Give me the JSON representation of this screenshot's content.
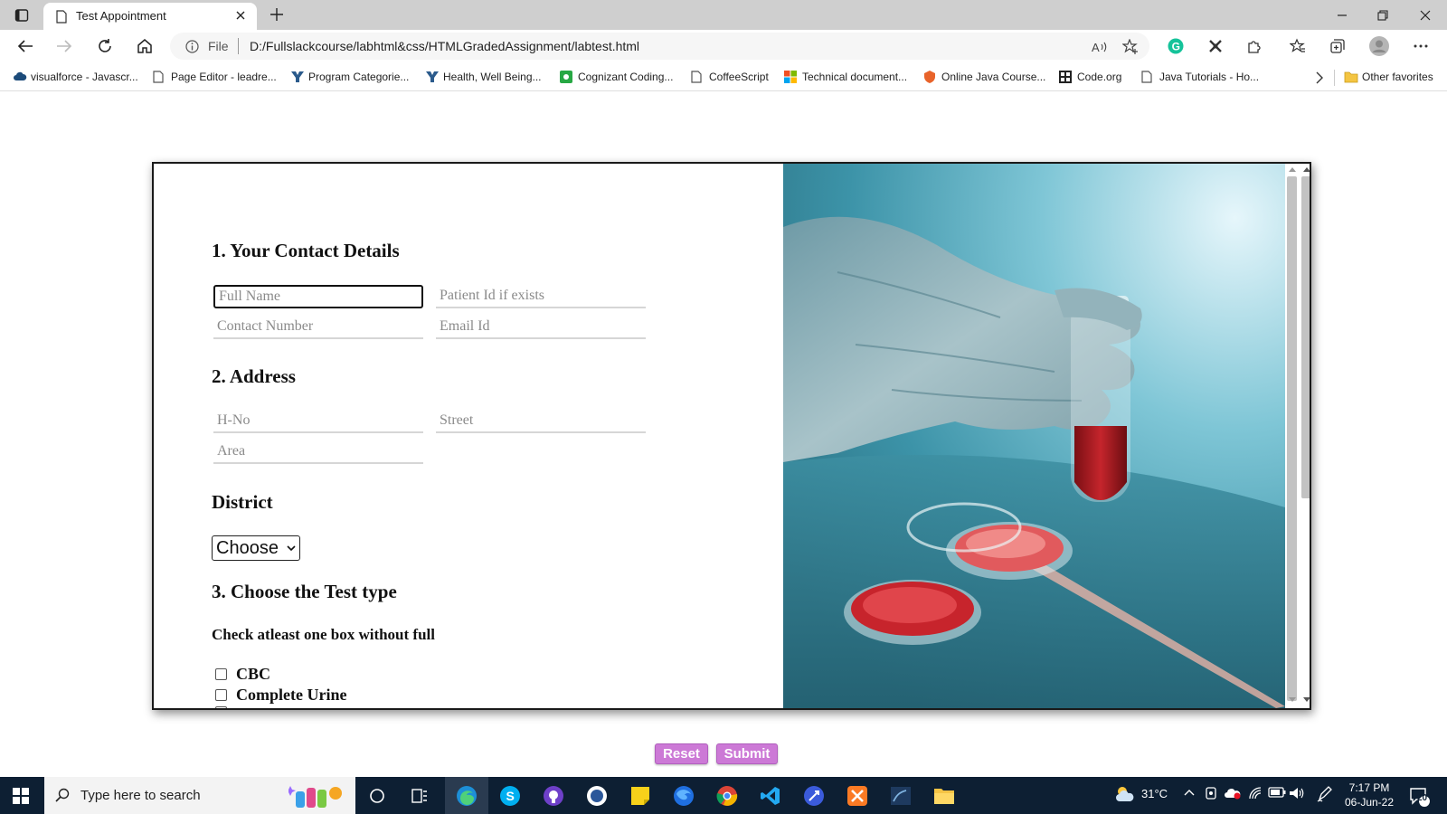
{
  "browser": {
    "tab_title": "Test Appointment",
    "url_scheme": "File",
    "url": "D:/Fullslackcourse/labhtml&css/HTMLGradedAssignment/labtest.html"
  },
  "bookmarks": [
    {
      "label": "visualforce - Javascr...",
      "icon": "cloud-icon",
      "color": "#1c4b7a"
    },
    {
      "label": "Page Editor - leadre...",
      "icon": "page-icon",
      "color": "#555555"
    },
    {
      "label": "Program Categorie...",
      "icon": "y-logo-icon",
      "color": "#2b5b8c"
    },
    {
      "label": "Health, Well Being...",
      "icon": "y-logo-icon",
      "color": "#2b5b8c"
    },
    {
      "label": "Cognizant Coding...",
      "icon": "cognizant-icon",
      "color": "#27a844"
    },
    {
      "label": "CoffeeScript",
      "icon": "page-icon",
      "color": "#555555"
    },
    {
      "label": "Technical document...",
      "icon": "microsoft-icon",
      "color": "#f25022"
    },
    {
      "label": "Online Java Course...",
      "icon": "shield-icon",
      "color": "#e8632a"
    },
    {
      "label": "Code.org",
      "icon": "grid-icon",
      "color": "#222222"
    },
    {
      "label": "Java Tutorials - Ho...",
      "icon": "page-icon",
      "color": "#555555"
    }
  ],
  "other_favorites": "Other favorites",
  "form": {
    "section1_title": "1. Your Contact Details",
    "full_name_placeholder": "Full Name",
    "patient_id_placeholder": "Patient Id if exists",
    "contact_placeholder": "Contact Number",
    "email_placeholder": "Email Id",
    "section2_title": "2. Address",
    "hno_placeholder": "H-No",
    "street_placeholder": "Street",
    "area_placeholder": "Area",
    "district_title": "District",
    "district_select": "Choose",
    "section3_title": "3. Choose the Test type",
    "check_note": "Check atleast one box without full",
    "tests": [
      "CBC",
      "Complete Urine"
    ]
  },
  "buttons": {
    "reset": "Reset",
    "submit": "Submit"
  },
  "taskbar": {
    "search_placeholder": "Type here to search",
    "weather": "31°C",
    "time": "7:17 PM",
    "date": "06-Jun-22",
    "notification_count": "20"
  },
  "colors": {
    "button_purple": "#cc79d6",
    "taskbar_bg": "#0d1f33"
  }
}
